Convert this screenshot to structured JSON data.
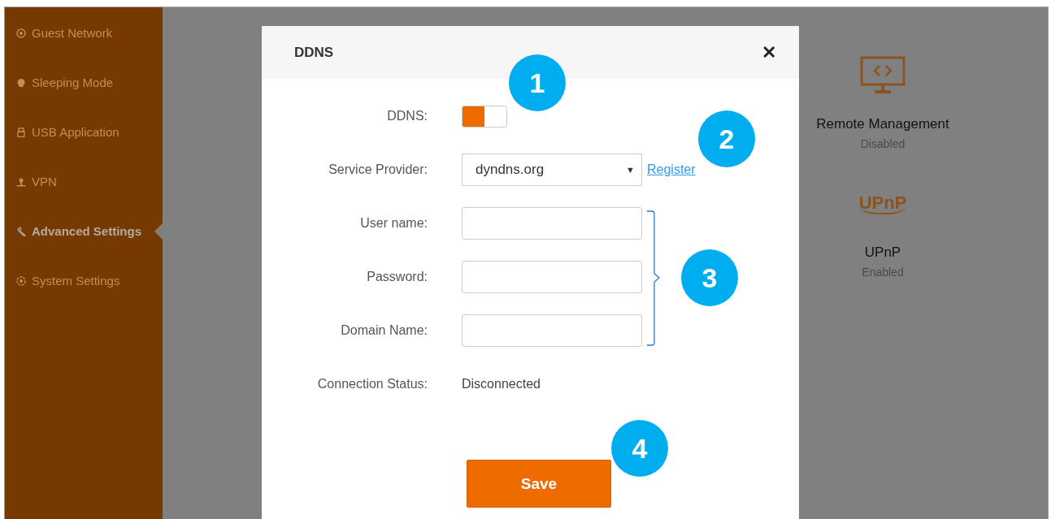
{
  "sidebar": {
    "items": [
      {
        "label": "Guest Network",
        "selected": false
      },
      {
        "label": "Sleeping Mode",
        "selected": false
      },
      {
        "label": "USB Application",
        "selected": false
      },
      {
        "label": "VPN",
        "selected": false
      },
      {
        "label": "Advanced Settings",
        "selected": true
      },
      {
        "label": "System Settings",
        "selected": false
      }
    ]
  },
  "cards": [
    {
      "title": "Remote Management",
      "status": "Disabled"
    },
    {
      "logo_text": "UPnP",
      "title": "UPnP",
      "status": "Enabled"
    }
  ],
  "dialog": {
    "title": "DDNS",
    "close": "✕",
    "fields": [
      {
        "kind": "toggle",
        "label": "DDNS:",
        "on": true
      },
      {
        "kind": "select",
        "label": "Service Provider:",
        "value": "dyndns.org",
        "caret": "▼",
        "link": "Register"
      },
      {
        "kind": "input",
        "label": "User name:"
      },
      {
        "kind": "input",
        "label": "Password:"
      },
      {
        "kind": "input",
        "label": "Domain Name:"
      },
      {
        "kind": "text",
        "label": "Connection Status:",
        "value": "Disconnected"
      }
    ],
    "save": "Save"
  },
  "callouts": [
    "1",
    "2",
    "3",
    "4"
  ]
}
